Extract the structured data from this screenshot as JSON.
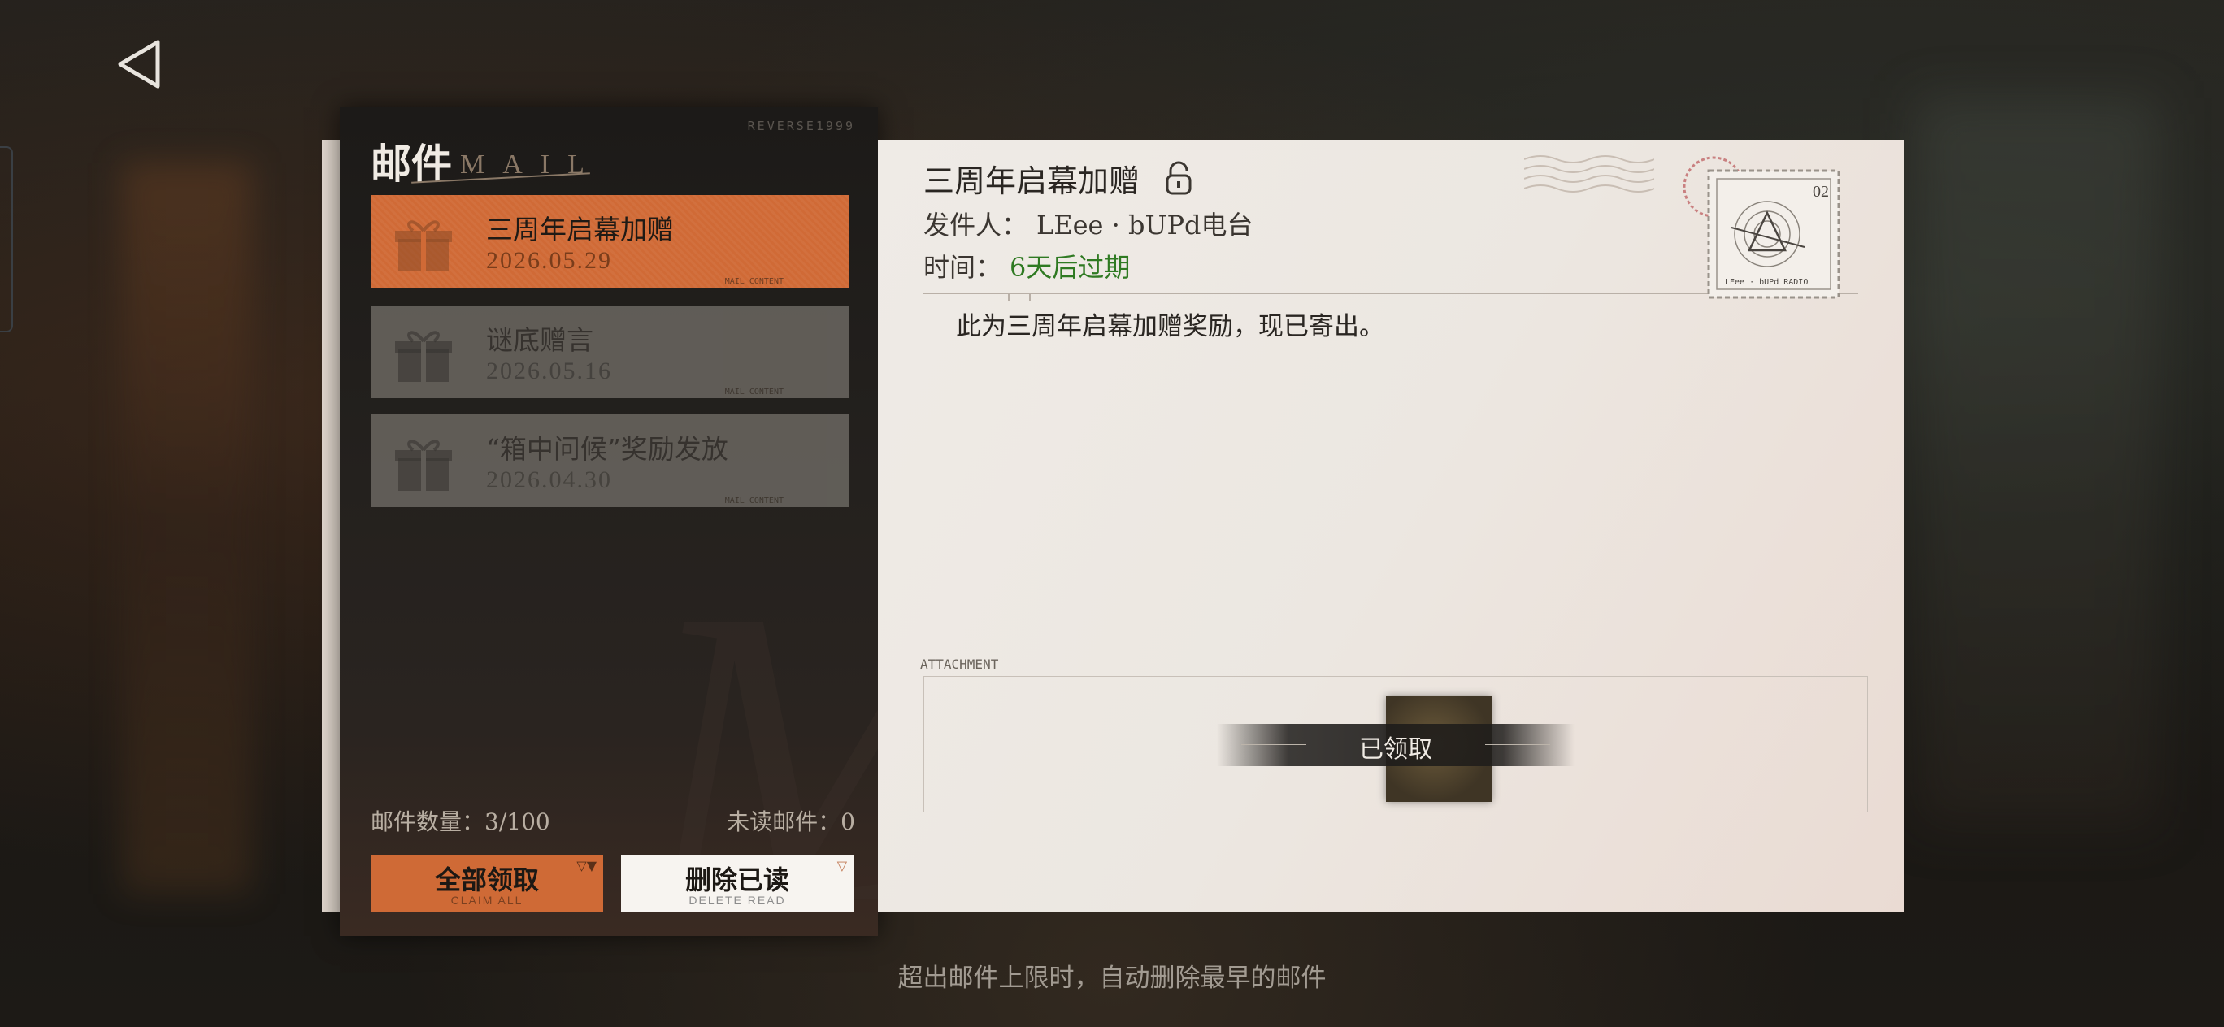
{
  "panel": {
    "title": "邮件",
    "title_en": "MAIL",
    "watermark": "REVERSE1999"
  },
  "mails": [
    {
      "title": "三周年启幕加赠",
      "date": "2026.05.29",
      "active": true
    },
    {
      "title": "谜底赠言",
      "date": "2026.05.16",
      "active": false
    },
    {
      "title": "“箱中问候”奖励发放",
      "date": "2026.04.30",
      "active": false
    }
  ],
  "mail_item_tag": "MAIL CONTENT",
  "stats": {
    "count": "邮件数量：3/100",
    "unread": "未读邮件：0"
  },
  "buttons": {
    "claim_all": "全部领取",
    "claim_all_sub": "CLAIM ALL",
    "delete_read": "删除已读",
    "delete_read_sub": "DELETE READ"
  },
  "letter": {
    "title": "三周年启幕加赠",
    "sender_label": "发件人：",
    "sender": "LEee · bUPd电台",
    "time_label": "时间：",
    "time_value": "6天后过期",
    "body": "此为三周年启幕加赠奖励，现已寄出。",
    "attachment_label": "ATTACHMENT",
    "claimed": "已领取",
    "stamp_number": "02",
    "stamp_text": "LEee · bUPd RADIO"
  },
  "footer": "超出邮件上限时，自动删除最早的邮件",
  "colors": {
    "accent_orange": "#cf6a36",
    "expire_green": "#2f7a22",
    "panel_dark": "#1c1a18",
    "paper": "#ece7e1"
  }
}
